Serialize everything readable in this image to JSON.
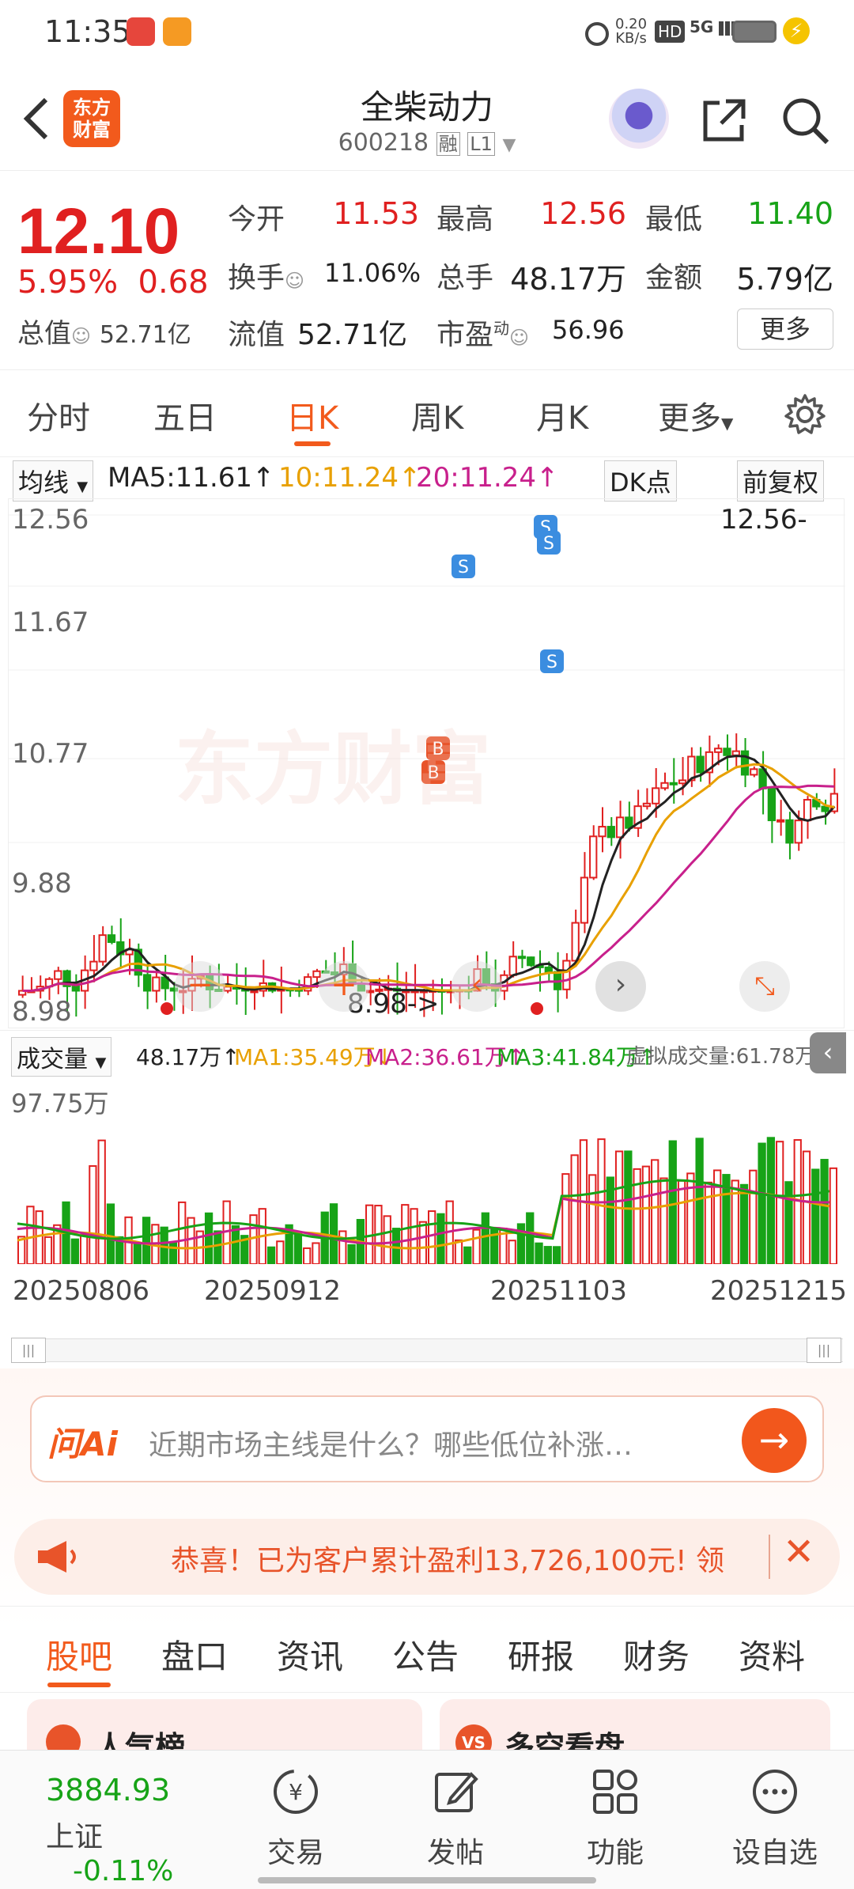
{
  "status_bar": {
    "time": "11:35",
    "net_speed_top": "0.20",
    "net_speed_unit": "KB/s",
    "hd": "HD",
    "net": "5G"
  },
  "header": {
    "back_label": "<",
    "logo_line1": "东方",
    "logo_line2": "财富",
    "stock_name": "全柴动力",
    "stock_code": "600218",
    "tag_rong": "融",
    "tag_level": "L1"
  },
  "quote": {
    "price": "12.10",
    "change_pct": "5.95%",
    "change": "0.68",
    "market_cap_label": "总值",
    "market_cap": "52.71亿",
    "open_label": "今开",
    "open": "11.53",
    "high_label": "最高",
    "high": "12.56",
    "low_label": "最低",
    "low": "11.40",
    "turnover_label": "换手",
    "turnover": "11.06%",
    "volume_label": "总手",
    "volume": "48.17万",
    "amount_label": "金额",
    "amount": "5.79亿",
    "float_cap_label": "流值",
    "float_cap": "52.71亿",
    "pe_label": "市盈",
    "pe_sup": "动",
    "pe": "56.96",
    "more_button": "更多"
  },
  "kline_tabs": [
    {
      "label": "分时"
    },
    {
      "label": "五日"
    },
    {
      "label": "日K"
    },
    {
      "label": "周K"
    },
    {
      "label": "月K"
    },
    {
      "label": "更多"
    }
  ],
  "ma_legend": {
    "selector": "均线",
    "ma5": "MA5:11.61↑",
    "ma10": "10:11.24↑",
    "ma20": "20:11.24↑",
    "dk_button": "DK点",
    "adjust_button": "前复权"
  },
  "kchart": {
    "y_labels": [
      "12.56",
      "11.67",
      "10.77",
      "9.88",
      "8.98"
    ],
    "high_marker": "12.56",
    "low_marker": "8.98",
    "watermark": "东方财富",
    "signal_s": "S",
    "signal_b": "B",
    "colors": {
      "up": "#e02020",
      "down": "#17a317",
      "ma5": "#222222",
      "ma10": "#e8a000",
      "ma20": "#c8208c"
    }
  },
  "volume": {
    "selector": "成交量",
    "vol": "48.17万↑",
    "ma1": "MA1:35.49万↓",
    "ma2": "MA2:36.61万↑",
    "ma3": "MA3:41.84万↑",
    "virtual": "虚拟成交量:61.78万",
    "max_label": "97.75万"
  },
  "dates": [
    "20250806",
    "20250912",
    "20251103",
    "20251215"
  ],
  "ai": {
    "logo": "问Ai",
    "placeholder": "近期市场主线是什么？哪些低位补涨…"
  },
  "banner": {
    "text": "恭喜！已为客户累计盈利13,726,100元! 领"
  },
  "bottom_tabs": [
    {
      "label": "股吧"
    },
    {
      "label": "盘口"
    },
    {
      "label": "资讯"
    },
    {
      "label": "公告"
    },
    {
      "label": "研报"
    },
    {
      "label": "财务"
    },
    {
      "label": "资料"
    }
  ],
  "cards": {
    "left": "人气榜",
    "right": "多空看盘",
    "right_badge": "VS"
  },
  "index": {
    "value": "3884.93",
    "name": "上证",
    "change": "-0.11%"
  },
  "nav": [
    {
      "label": "交易"
    },
    {
      "label": "发帖"
    },
    {
      "label": "功能"
    },
    {
      "label": "设自选"
    }
  ]
}
